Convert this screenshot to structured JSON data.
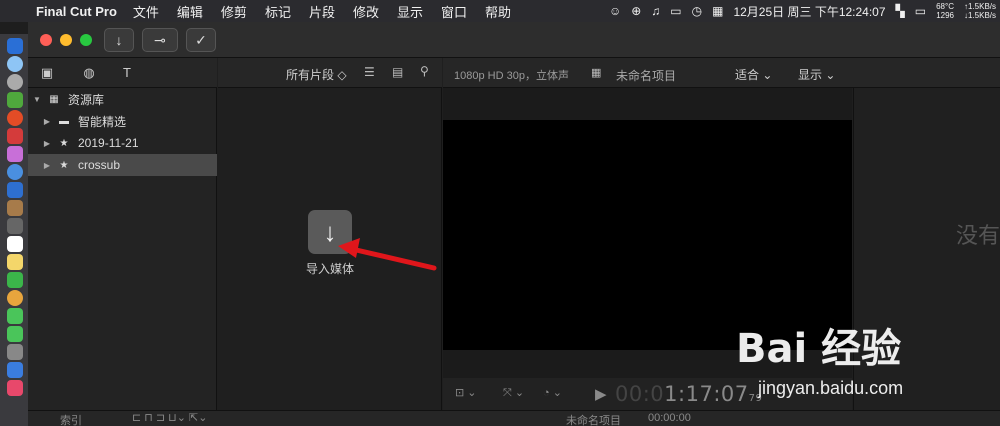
{
  "menubar": {
    "app_name": "Final Cut Pro",
    "items": [
      "文件",
      "编辑",
      "修剪",
      "标记",
      "片段",
      "修改",
      "显示",
      "窗口",
      "帮助"
    ],
    "datetime": "12月25日 周三 下午12:24:07",
    "temp": "68°C",
    "rpm": "1296",
    "net_up": "1.5KB/s",
    "net_down": "1.5KB/s"
  },
  "toolbar": {
    "import_icon": "↓",
    "keyword_icon": "⊸",
    "check_icon": "✓"
  },
  "browser": {
    "filter_label": "所有片段 ◇",
    "import_label": "导入媒体"
  },
  "sidebar": {
    "library": "资源库",
    "items": [
      {
        "label": "智能精选"
      },
      {
        "label": "2019-11-21"
      },
      {
        "label": "crossub"
      }
    ]
  },
  "viewer": {
    "format": "1080p HD 30p，立体声",
    "project": "未命名项目",
    "fit": "适合 ⌄",
    "view": "显示 ⌄",
    "timecode_dim": "00:0",
    "timecode": "1:17:07",
    "frames": "79"
  },
  "inspector": {
    "empty_text": "没有"
  },
  "timeline": {
    "index": "索引",
    "project": "未命名项目",
    "time": "00:00:00"
  },
  "watermark": {
    "logo": "Bai 经验",
    "url": "jingyan.baidu.com"
  },
  "colors": {
    "accent_arrow": "#e0161b",
    "selected_row": "#4a4a4a"
  }
}
